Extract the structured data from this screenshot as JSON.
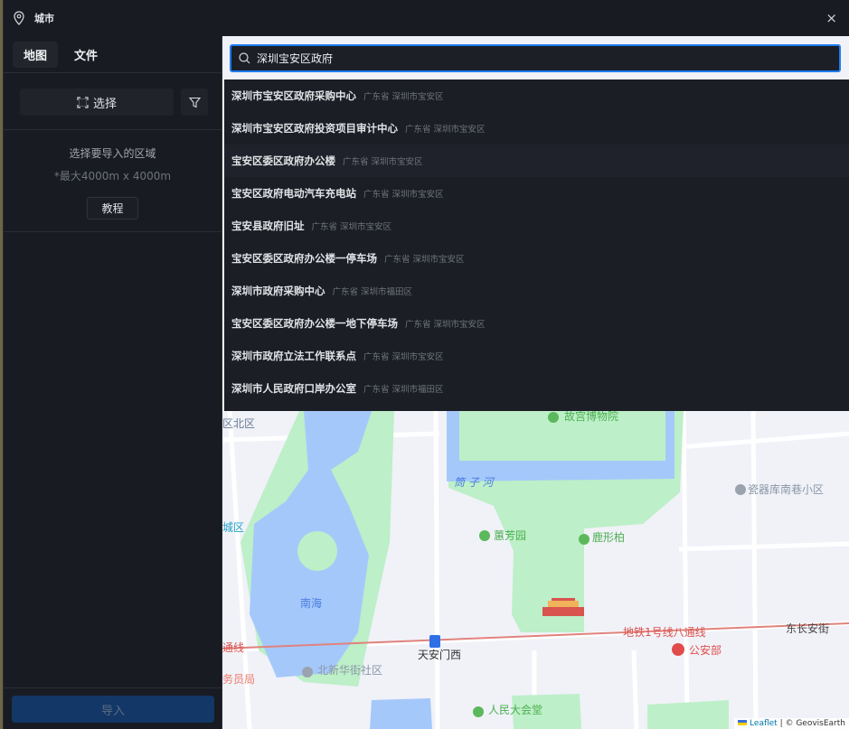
{
  "window": {
    "title": "城市",
    "close": "×"
  },
  "tabs": [
    {
      "label": "地图"
    },
    {
      "label": "文件"
    }
  ],
  "toolbar": {
    "select_label": "选择"
  },
  "info": {
    "line1": "选择要导入的区域",
    "line2": "*最大4000m x 4000m",
    "tutorial": "教程"
  },
  "import_label": "导入",
  "search": {
    "value": "深圳宝安区政府"
  },
  "results": [
    {
      "name": "深圳市宝安区政府采购中心",
      "sub": "广东省 深圳市宝安区"
    },
    {
      "name": "深圳市宝安区政府投资项目审计中心",
      "sub": "广东省 深圳市宝安区"
    },
    {
      "name": "宝安区委区政府办公楼",
      "sub": "广东省 深圳市宝安区"
    },
    {
      "name": "宝安区政府电动汽车充电站",
      "sub": "广东省 深圳市宝安区"
    },
    {
      "name": "宝安县政府旧址",
      "sub": "广东省 深圳市宝安区"
    },
    {
      "name": "宝安区委区政府办公楼一停车场",
      "sub": "广东省 深圳市宝安区"
    },
    {
      "name": "深圳市政府采购中心",
      "sub": "广东省 深圳市福田区"
    },
    {
      "name": "宝安区委区政府办公楼一地下停车场",
      "sub": "广东省 深圳市宝安区"
    },
    {
      "name": "深圳市政府立法工作联系点",
      "sub": "广东省 深圳市宝安区"
    },
    {
      "name": "深圳市人民政府口岸办公室",
      "sub": "广东省 深圳市福田区"
    }
  ],
  "map_labels": {
    "gugong": "故宫博物院",
    "qbq": "区北区",
    "tongzihe": "筒 子 河",
    "cqk": "瓷器库南巷小区",
    "cheng": "城区",
    "huifang": "蕙芳园",
    "luxing": "鹿形柏",
    "nanhai": "南海",
    "line1": "地铁1号线八通线",
    "dongchang": "东长安街",
    "tongxian": "通线",
    "tamx": "天安门西",
    "gonganbu": "公安部",
    "bxh": "北新华街社区",
    "wuyuan": "务员局",
    "rmdht": "人民大会堂"
  },
  "attribution": {
    "leaflet": "Leaflet",
    "rest": " | © GeovisEarth"
  }
}
